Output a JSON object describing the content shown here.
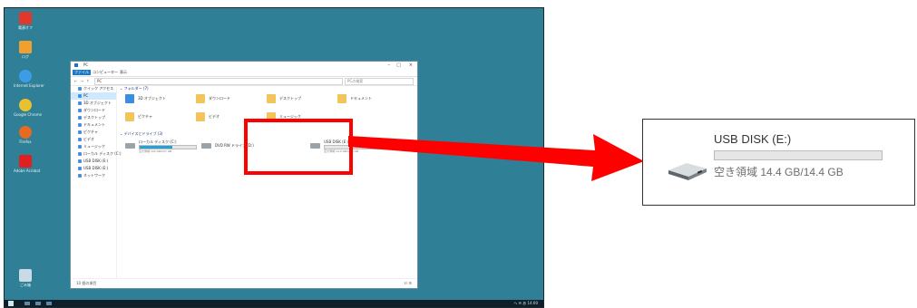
{
  "desktop": {
    "icons": [
      {
        "label": "電源オフ"
      },
      {
        "label": "ログ"
      },
      {
        "label": "Internet Explorer"
      },
      {
        "label": "Google Chrome"
      },
      {
        "label": "Firefox"
      },
      {
        "label": "Adobe Acrobat"
      },
      {
        "label": "ごみ箱"
      }
    ],
    "taskbar": {
      "tray_text": "へ ✉ あ 14:00"
    }
  },
  "explorer": {
    "title": "PC",
    "ribbon_tabs": [
      "ファイル",
      "コンピューター",
      "表示"
    ],
    "nav_buttons": "← → ↑",
    "address": "PC",
    "search_placeholder": "PCの検索",
    "navpane": [
      "クイック アクセス",
      "PC",
      "3D オブジェクト",
      "ダウンロード",
      "デスクトップ",
      "ドキュメント",
      "ピクチャ",
      "ビデオ",
      "ミュージック",
      "ローカル ディスク (C:)",
      "USB DISK (E:)",
      "USB DISK (E:)",
      "ネットワーク"
    ],
    "folders_heading": "フォルダー (7)",
    "folders": [
      "3D オブジェクト",
      "ダウンロード",
      "デスクトップ",
      "ドキュメント",
      "ピクチャ",
      "ビデオ",
      "ミュージック"
    ],
    "drives_heading": "デバイスとドライブ (3)",
    "drives": [
      {
        "name": "ローカル ディスク (C:)",
        "free": "空き領域 100 GB/237 GB",
        "used_fraction": 0.58
      },
      {
        "name": "DVD RW ドライブ (D:)",
        "free": "",
        "used_fraction": null
      },
      {
        "name": "USB DISK (E:)",
        "free": "空き領域 14.4 GB/14.4 GB",
        "used_fraction": 0.0
      }
    ],
    "status": "10 個の項目",
    "view": "☷ ☰"
  },
  "zoom": {
    "drive_name": "USB DISK (E:)",
    "free_text": "空き領域 14.4 GB/14.4 GB",
    "used_fraction": 0.0
  },
  "colors": {
    "desktop_bg": "#2f7f97",
    "highlight": "#ff0000",
    "arrow": "#ff0000",
    "capacity_bar_bg": "#e6e6e6"
  }
}
